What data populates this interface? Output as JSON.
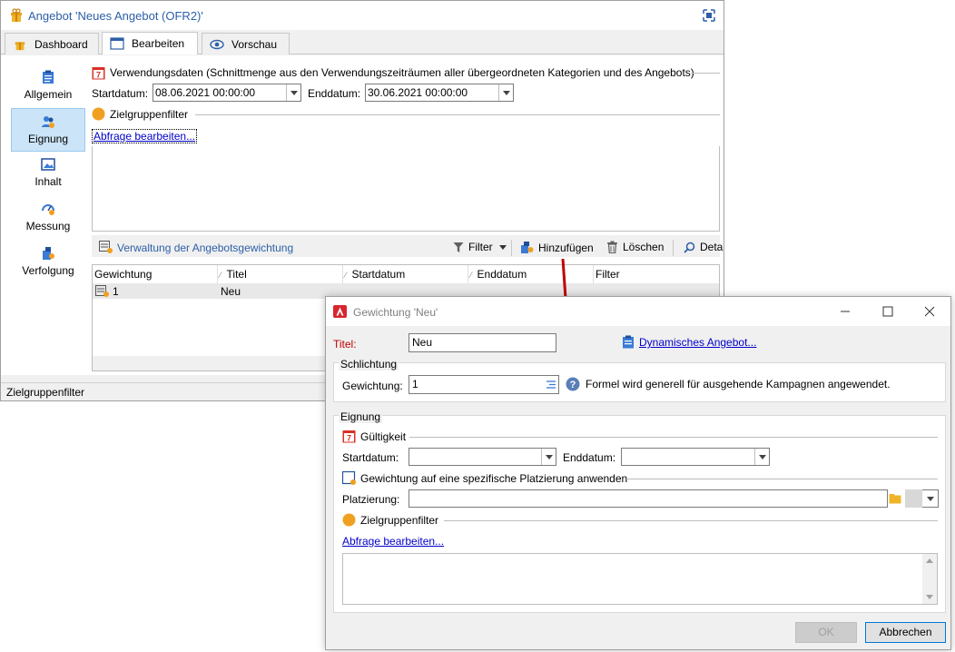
{
  "main": {
    "title": "Angebot 'Neues Angebot (OFR2)'",
    "tabs": [
      {
        "label": "Dashboard"
      },
      {
        "label": "Bearbeiten"
      },
      {
        "label": "Vorschau"
      }
    ],
    "nav": [
      {
        "label": "Allgemein"
      },
      {
        "label": "Eignung"
      },
      {
        "label": "Inhalt"
      },
      {
        "label": "Messung"
      },
      {
        "label": "Verfolgung"
      }
    ],
    "usage_section": "Verwendungsdaten (Schnittmenge aus den Verwendungszeiträumen aller übergeordneten Kategorien und des Angebots)",
    "start_label": "Startdatum:",
    "start_value": "08.06.2021 00:00:00",
    "end_label": "Enddatum:",
    "end_value": "30.06.2021 00:00:00",
    "target_section": "Zielgruppenfilter",
    "edit_query": "Abfrage bearbeiten...",
    "weighting_mgmt": "Verwaltung der Angebotsgewichtung",
    "toolbar": {
      "filter": "Filter",
      "add": "Hinzufügen",
      "delete": "Löschen",
      "details": "Deta"
    },
    "grid": {
      "headers": [
        "Gewichtung",
        "Titel",
        "Startdatum",
        "Enddatum",
        "Filter"
      ],
      "rows": [
        {
          "weight": "1",
          "title": "Neu"
        }
      ]
    },
    "status": "Zielgruppenfilter"
  },
  "dialog": {
    "title": "Gewichtung 'Neu'",
    "title_label": "Titel:",
    "title_value": "Neu",
    "dynamic_offer": "Dynamisches Angebot...",
    "arbitration_group": "Schlichtung",
    "weight_label": "Gewichtung:",
    "weight_value": "1",
    "formula_note": "Formel wird generell für ausgehende Kampagnen angewendet.",
    "eligibility_group": "Eignung",
    "validity": "Gültigkeit",
    "start_label": "Startdatum:",
    "end_label": "Enddatum:",
    "placement_check": "Gewichtung auf eine spezifische Platzierung anwenden",
    "placement_label": "Platzierung:",
    "target_section": "Zielgruppenfilter",
    "edit_query": "Abfrage bearbeiten...",
    "ok": "OK",
    "cancel": "Abbrechen"
  },
  "colors": {
    "accent_blue": "#2c5fa8",
    "link": "#0000cc",
    "required_red": "#c00000",
    "arrow_red": "#c00000",
    "nav_active": "#cce4f7"
  }
}
